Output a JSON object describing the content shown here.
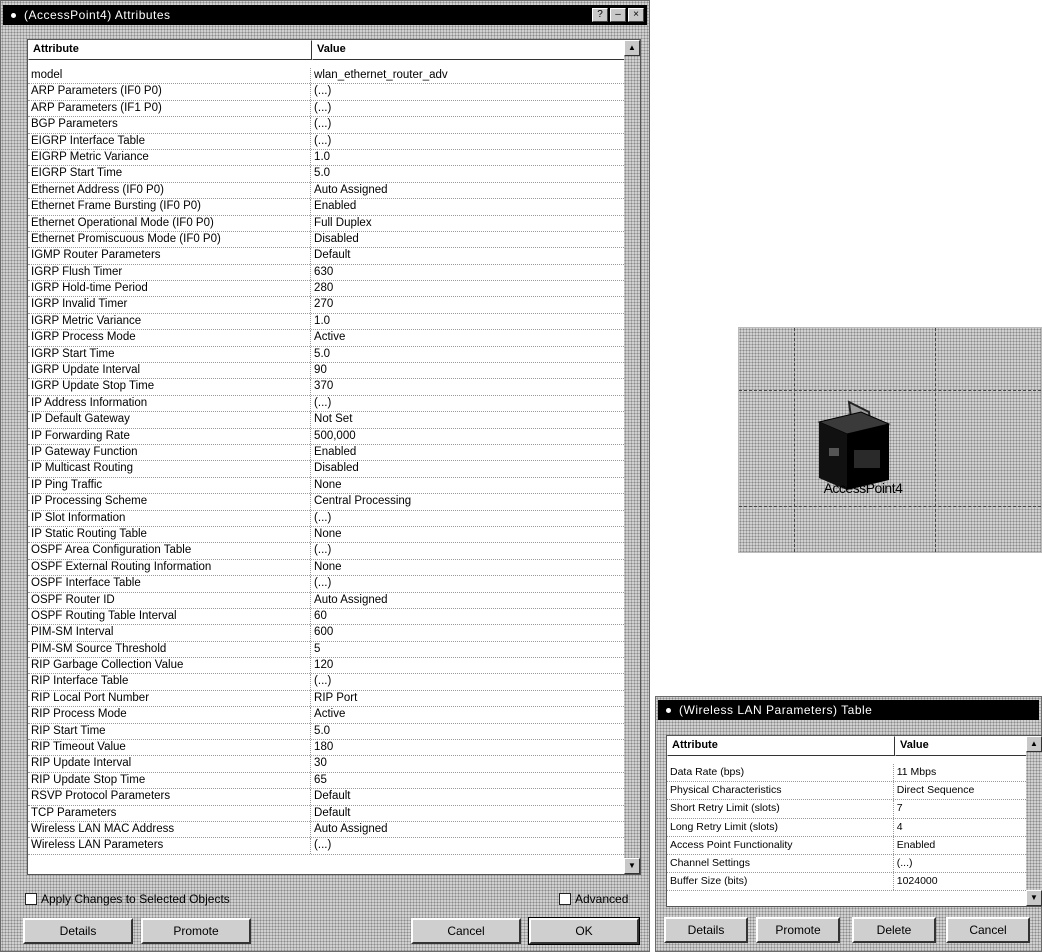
{
  "main_dialog": {
    "title": "(AccessPoint4) Attributes",
    "title_buttons": [
      "?",
      "–",
      "×"
    ],
    "columns": {
      "attribute": "Attribute",
      "value": "Value"
    },
    "rows": [
      {
        "attr": "model",
        "value": "wlan_ethernet_router_adv"
      },
      {
        "attr": "ARP Parameters (IF0 P0)",
        "value": "(...)"
      },
      {
        "attr": "ARP Parameters (IF1 P0)",
        "value": "(...)"
      },
      {
        "attr": "BGP Parameters",
        "value": "(...)"
      },
      {
        "attr": "EIGRP Interface Table",
        "value": "(...)"
      },
      {
        "attr": "EIGRP Metric Variance",
        "value": "1.0"
      },
      {
        "attr": "EIGRP Start Time",
        "value": "5.0"
      },
      {
        "attr": "Ethernet Address (IF0 P0)",
        "value": "Auto Assigned"
      },
      {
        "attr": "Ethernet Frame Bursting (IF0 P0)",
        "value": "Enabled"
      },
      {
        "attr": "Ethernet Operational Mode (IF0 P0)",
        "value": "Full Duplex"
      },
      {
        "attr": "Ethernet Promiscuous Mode (IF0 P0)",
        "value": "Disabled"
      },
      {
        "attr": "IGMP Router Parameters",
        "value": "Default"
      },
      {
        "attr": "IGRP Flush Timer",
        "value": "630"
      },
      {
        "attr": "IGRP Hold-time Period",
        "value": "280"
      },
      {
        "attr": "IGRP Invalid Timer",
        "value": "270"
      },
      {
        "attr": "IGRP Metric Variance",
        "value": "1.0"
      },
      {
        "attr": "IGRP Process Mode",
        "value": "Active"
      },
      {
        "attr": "IGRP Start Time",
        "value": "5.0"
      },
      {
        "attr": "IGRP Update Interval",
        "value": "90"
      },
      {
        "attr": "IGRP Update Stop Time",
        "value": "370"
      },
      {
        "attr": "IP Address Information",
        "value": "(...)"
      },
      {
        "attr": "IP Default Gateway",
        "value": "Not Set"
      },
      {
        "attr": "IP Forwarding Rate",
        "value": "500,000"
      },
      {
        "attr": "IP Gateway Function",
        "value": "Enabled"
      },
      {
        "attr": "IP Multicast Routing",
        "value": "Disabled"
      },
      {
        "attr": "IP Ping Traffic",
        "value": "None"
      },
      {
        "attr": "IP Processing Scheme",
        "value": "Central Processing"
      },
      {
        "attr": "IP Slot Information",
        "value": "(...)"
      },
      {
        "attr": "IP Static Routing Table",
        "value": "None"
      },
      {
        "attr": "OSPF Area Configuration Table",
        "value": "(...)"
      },
      {
        "attr": "OSPF External Routing Information",
        "value": "None"
      },
      {
        "attr": "OSPF Interface Table",
        "value": "(...)"
      },
      {
        "attr": "OSPF Router ID",
        "value": "Auto Assigned"
      },
      {
        "attr": "OSPF Routing Table Interval",
        "value": "60"
      },
      {
        "attr": "PIM-SM Interval",
        "value": "600"
      },
      {
        "attr": "PIM-SM Source Threshold",
        "value": "5"
      },
      {
        "attr": "RIP Garbage Collection Value",
        "value": "120"
      },
      {
        "attr": "RIP Interface Table",
        "value": "(...)"
      },
      {
        "attr": "RIP Local Port Number",
        "value": "RIP Port"
      },
      {
        "attr": "RIP Process Mode",
        "value": "Active"
      },
      {
        "attr": "RIP Start Time",
        "value": "5.0"
      },
      {
        "attr": "RIP Timeout Value",
        "value": "180"
      },
      {
        "attr": "RIP Update Interval",
        "value": "30"
      },
      {
        "attr": "RIP Update Stop Time",
        "value": "65"
      },
      {
        "attr": "RSVP Protocol Parameters",
        "value": "Default"
      },
      {
        "attr": "TCP Parameters",
        "value": "Default"
      },
      {
        "attr": "Wireless LAN MAC Address",
        "value": "Auto Assigned"
      },
      {
        "attr": "Wireless LAN Parameters",
        "value": "(...)"
      }
    ],
    "apply_changes_label": "Apply Changes to Selected Objects",
    "advanced_label": "Advanced",
    "buttons": {
      "details": "Details",
      "promote": "Promote",
      "cancel": "Cancel",
      "ok": "OK"
    }
  },
  "canvas": {
    "node_label": "AccessPoint4",
    "node_icon": "wireless-router-icon"
  },
  "wireless_dialog": {
    "title": "(Wireless LAN Parameters) Table",
    "columns": {
      "attribute": "Attribute",
      "value": "Value"
    },
    "rows": [
      {
        "attr": "Data Rate (bps)",
        "value": "11 Mbps"
      },
      {
        "attr": "Physical Characteristics",
        "value": "Direct Sequence"
      },
      {
        "attr": "Short Retry Limit (slots)",
        "value": "7"
      },
      {
        "attr": "Long Retry Limit (slots)",
        "value": "4"
      },
      {
        "attr": "Access Point Functionality",
        "value": "Enabled"
      },
      {
        "attr": "Channel Settings",
        "value": "(...)"
      },
      {
        "attr": "Buffer Size (bits)",
        "value": "1024000"
      }
    ],
    "buttons": {
      "details": "Details",
      "promote": "Promote",
      "delete": "Delete",
      "cancel": "Cancel"
    }
  }
}
